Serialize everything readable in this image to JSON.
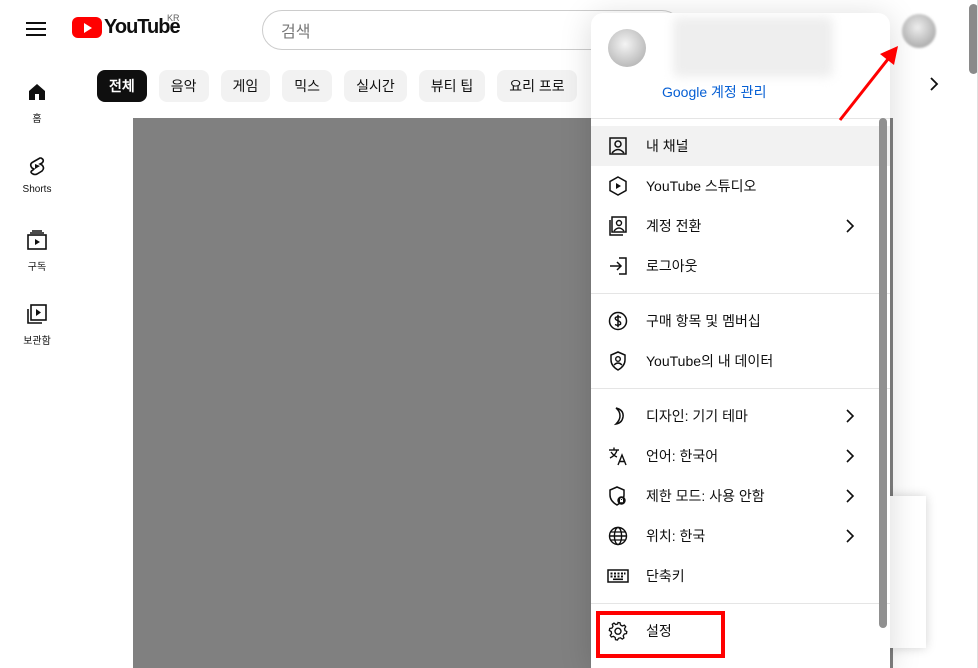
{
  "header": {
    "logo_text": "YouTube",
    "country_code": "KR",
    "search_placeholder": "검색"
  },
  "chips": [
    "전체",
    "음악",
    "게임",
    "믹스",
    "실시간",
    "뷰티 팁",
    "요리 프로"
  ],
  "leftnav": [
    {
      "label": "홈",
      "icon": "home-icon"
    },
    {
      "label": "Shorts",
      "icon": "shorts-icon"
    },
    {
      "label": "구독",
      "icon": "subscriptions-icon"
    },
    {
      "label": "보관함",
      "icon": "library-icon"
    }
  ],
  "account_menu": {
    "manage_account": "Google 계정 관리",
    "group1": [
      {
        "label": "내 채널",
        "icon": "account-box-icon",
        "chevron": false
      },
      {
        "label": "YouTube 스튜디오",
        "icon": "studio-icon",
        "chevron": false
      },
      {
        "label": "계정 전환",
        "icon": "switch-account-icon",
        "chevron": true
      },
      {
        "label": "로그아웃",
        "icon": "sign-out-icon",
        "chevron": false
      }
    ],
    "group2": [
      {
        "label": "구매 항목 및 멤버십",
        "icon": "dollar-icon",
        "chevron": false
      },
      {
        "label": "YouTube의 내 데이터",
        "icon": "shield-person-icon",
        "chevron": false
      }
    ],
    "group3": [
      {
        "label": "디자인: 기기 테마",
        "icon": "moon-icon",
        "chevron": true
      },
      {
        "label": "언어: 한국어",
        "icon": "translate-icon",
        "chevron": true
      },
      {
        "label": "제한 모드: 사용 안함",
        "icon": "restricted-shield-icon",
        "chevron": true
      },
      {
        "label": "위치: 한국",
        "icon": "globe-icon",
        "chevron": true
      },
      {
        "label": "단축키",
        "icon": "keyboard-icon",
        "chevron": false
      }
    ],
    "group4": [
      {
        "label": "설정",
        "icon": "gear-icon",
        "chevron": false
      }
    ]
  },
  "colors": {
    "brand": "#ff0000",
    "link": "#065fd4",
    "annotation": "#ff0000"
  }
}
